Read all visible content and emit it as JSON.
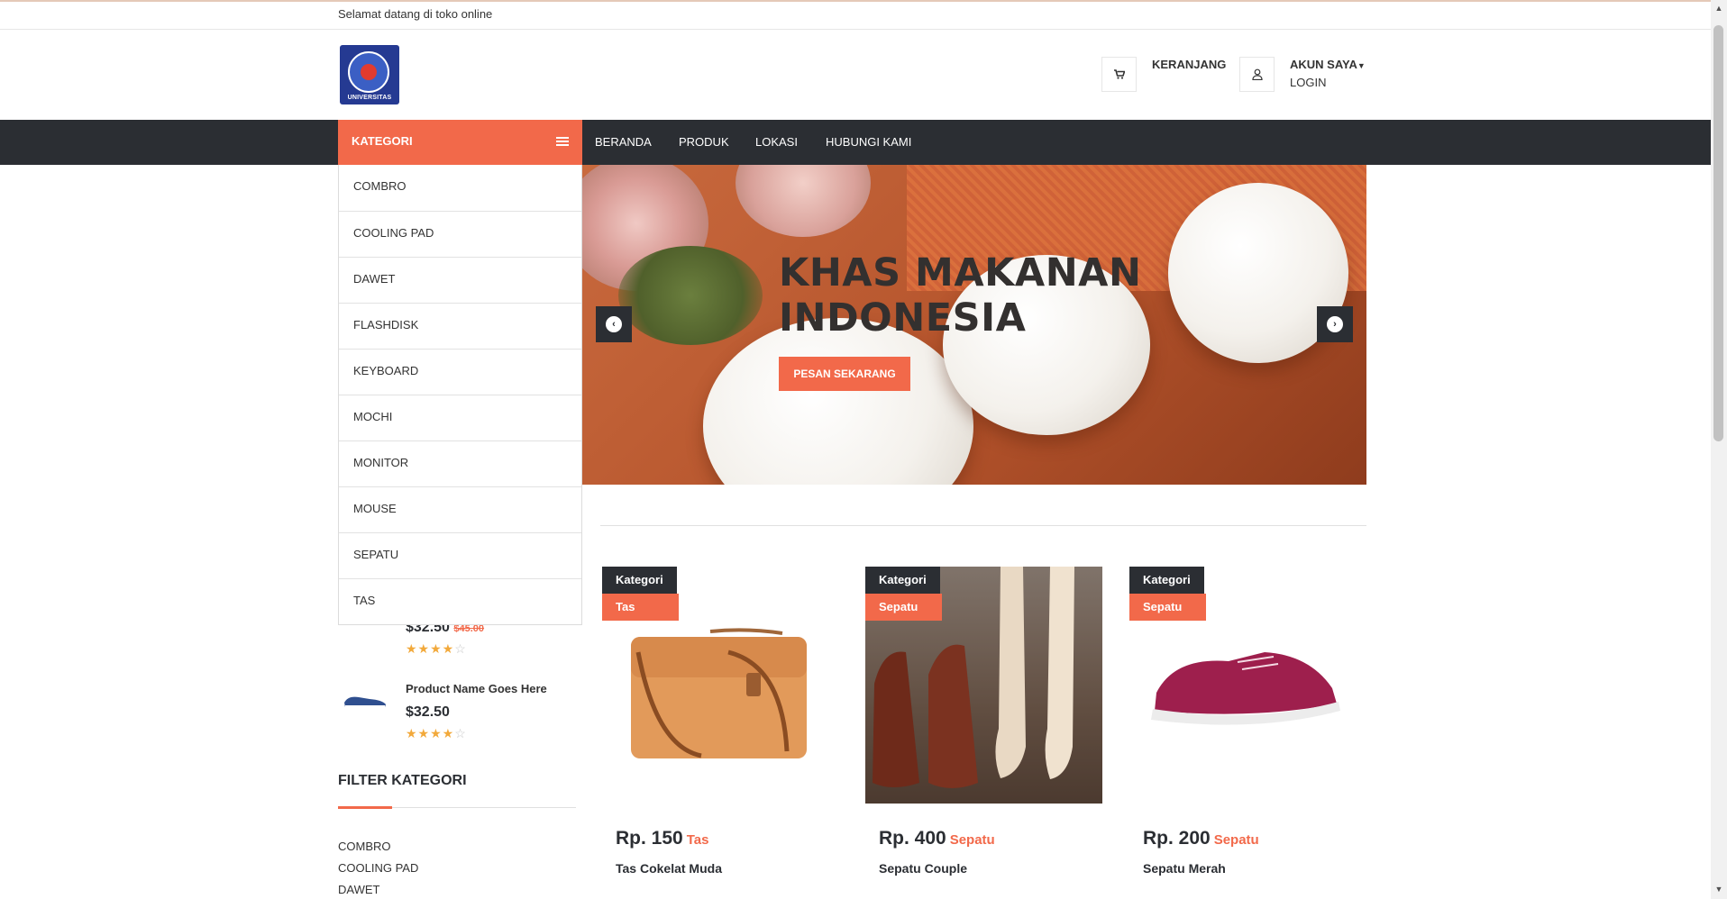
{
  "topbar": {
    "welcome": "Selamat datang di toko online"
  },
  "header": {
    "logo_text": "UNIVERSITAS",
    "cart_label": "KERANJANG",
    "account_label": "AKUN SAYA",
    "login_label": "LOGIN"
  },
  "nav": {
    "kategori_label": "KATEGORI",
    "links": [
      "BERANDA",
      "PRODUK",
      "LOKASI",
      "HUBUNGI KAMI"
    ]
  },
  "categories": [
    "COMBRO",
    "COOLING PAD",
    "DAWET",
    "FLASHDISK",
    "KEYBOARD",
    "MOCHI",
    "MONITOR",
    "MOUSE",
    "SEPATU",
    "TAS"
  ],
  "slider": {
    "title_line1": "KHAS MAKANAN",
    "title_line2": "INDONESIA",
    "button": "PESAN SEKARANG"
  },
  "sidebar_products": [
    {
      "price": "$32.50",
      "old_price": "$45.00",
      "rating": 4
    },
    {
      "name": "Product Name Goes Here",
      "price": "$32.50",
      "rating": 4
    }
  ],
  "filter": {
    "title": "FILTER KATEGORI",
    "items": [
      "COMBRO",
      "COOLING PAD",
      "DAWET"
    ]
  },
  "products": [
    {
      "badge": "Kategori",
      "category": "Tas",
      "price": "Rp. 150",
      "name": "Tas Cokelat Muda"
    },
    {
      "badge": "Kategori",
      "category": "Sepatu",
      "price": "Rp. 400",
      "name": "Sepatu Couple"
    },
    {
      "badge": "Kategori",
      "category": "Sepatu",
      "price": "Rp. 200",
      "name": "Sepatu Merah"
    }
  ],
  "colors": {
    "accent": "#f2694a",
    "dark": "#2b2e33"
  },
  "icons": {
    "cart": "cart-icon",
    "user": "user-icon",
    "menu": "menu-bars-icon",
    "prev": "chevron-left-icon",
    "next": "chevron-right-icon"
  }
}
